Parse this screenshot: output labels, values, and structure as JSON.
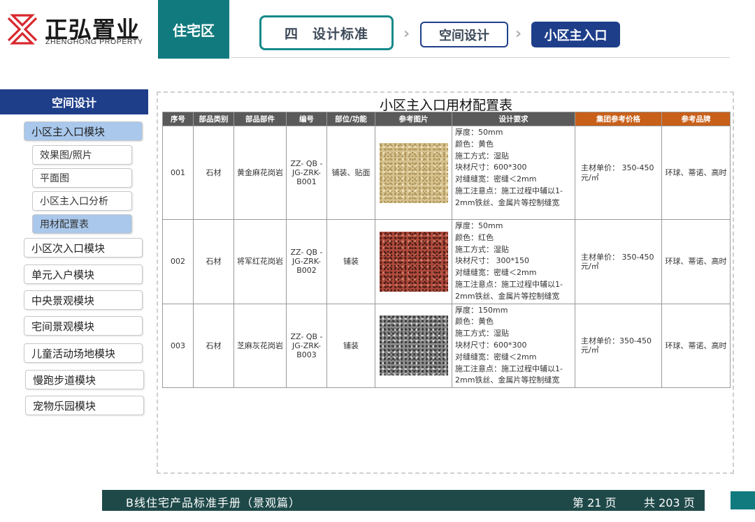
{
  "brand": {
    "name": "正弘置业",
    "sub": "ZHENGHONG PROPERTY",
    "colors": {
      "teal": "#117a7e",
      "navy": "#1e3e8a",
      "red": "#d8282e",
      "orange": "#c8601a"
    }
  },
  "header": {
    "section": "住宅区",
    "breadcrumb": [
      {
        "num": "四",
        "label": "设计标准"
      },
      {
        "label": "空间设计"
      },
      {
        "label": "小区主入口"
      }
    ]
  },
  "sidebar": {
    "heading": "空间设计",
    "modules": [
      {
        "label": "小区主入口模块",
        "active": true
      },
      {
        "label": "小区次入口模块"
      },
      {
        "label": "单元入户模块"
      },
      {
        "label": "中央景观模块"
      },
      {
        "label": "宅间景观模块"
      },
      {
        "label": "儿童活动场地模块"
      },
      {
        "label": "慢跑步道模块"
      },
      {
        "label": "宠物乐园模块"
      }
    ],
    "subs": [
      {
        "label": "效果图/照片"
      },
      {
        "label": "平面图"
      },
      {
        "label": "小区主入口分析"
      },
      {
        "label": "用材配置表",
        "active": true
      }
    ]
  },
  "table": {
    "title": "小区主入口用材配置表",
    "columns": [
      "序号",
      "部品类别",
      "部品部件",
      "编号",
      "部位/功能",
      "参考图片",
      "设计要求",
      "集团参考价格",
      "参考品牌"
    ],
    "rows": [
      {
        "no": "001",
        "category": "石材",
        "part": "黄金麻花岗岩",
        "code": "ZZ- QB - JG-ZRK- B001",
        "position": "铺装、贴面",
        "image": "yellow-granite-swatch",
        "req": [
          "厚度：50mm",
          "颜色：黄色",
          "施工方式：湿贴",
          "块材尺寸：600*300",
          "对缝缝宽：密缝＜2mm",
          "施工注意点：施工过程中辅以1-2mm铁丝、金属片等控制缝宽"
        ],
        "price": "主材单价：  350-450元/㎡",
        "brand": "环球、蒂诺、高时"
      },
      {
        "no": "002",
        "category": "石材",
        "part": "将军红花岗岩",
        "code": "ZZ- QB - JG-ZRK- B002",
        "position": "铺装",
        "image": "red-granite-swatch",
        "req": [
          "厚度：50mm",
          "颜色：红色",
          "施工方式：湿贴",
          "块材尺寸：  300*150",
          "对缝缝宽：密缝＜2mm",
          "施工注意点：施工过程中辅以1-2mm铁丝、金属片等控制缝宽"
        ],
        "price": "主材单价：  350-450元/㎡",
        "brand": "环球、蒂诺、高时"
      },
      {
        "no": "003",
        "category": "石材",
        "part": "芝麻灰花岗岩",
        "code": "ZZ- QB - JG-ZRK- B003",
        "position": "铺装",
        "image": "grey-granite-swatch",
        "req": [
          "厚度：150mm",
          "颜色：黄色",
          "施工方式：湿贴",
          "块材尺寸：600*300",
          "对缝缝宽：密缝＜2mm",
          "施工注意点：施工过程中辅以1-2mm铁丝、金属片等控制缝宽"
        ],
        "price": "主材单价：350-450元/㎡",
        "brand": "环球、蒂诺、高时"
      }
    ]
  },
  "footer": {
    "title": "B线住宅产品标准手册（景观篇）",
    "page": "第 21 页",
    "total": "共 203 页"
  }
}
